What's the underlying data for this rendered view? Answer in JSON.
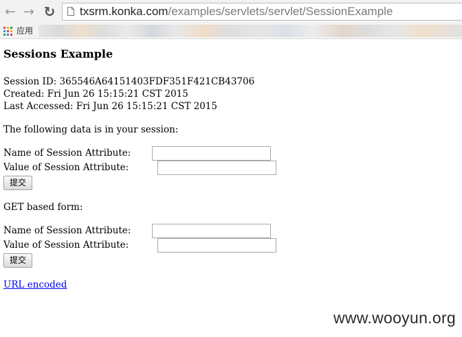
{
  "browser": {
    "url_host": "txsrm.konka.com",
    "url_path": "/examples/servlets/servlet/SessionExample",
    "bookmarks_apps_label": "应用"
  },
  "page": {
    "title": "Sessions Example",
    "session_id": "Session ID: 365546A64151403FDF351F421CB43706",
    "created": "Created: Fri Jun 26 15:15:21 CST 2015",
    "last_accessed": "Last Accessed: Fri Jun 26 15:15:21 CST 2015",
    "data_intro": "The following data is in your session:",
    "post_form": {
      "name_label": "Name of Session Attribute:",
      "name_value": "",
      "value_label": "Value of Session Attribute:",
      "value_value": "",
      "submit_label": "提交"
    },
    "get_form_heading": "GET based form:",
    "get_form": {
      "name_label": "Name of Session Attribute:",
      "name_value": "",
      "value_label": "Value of Session Attribute:",
      "value_value": "",
      "submit_label": "提交"
    },
    "url_encoded_link": "URL encoded"
  },
  "watermark": "www.wooyun.org",
  "icons": {
    "back": "back-arrow-icon",
    "forward": "forward-arrow-icon",
    "reload": "reload-icon",
    "page": "page-icon",
    "apps": "apps-grid-icon"
  },
  "colors": {
    "link": "#0000ee",
    "url_host": "#222222",
    "url_path": "#7a7a7a"
  }
}
